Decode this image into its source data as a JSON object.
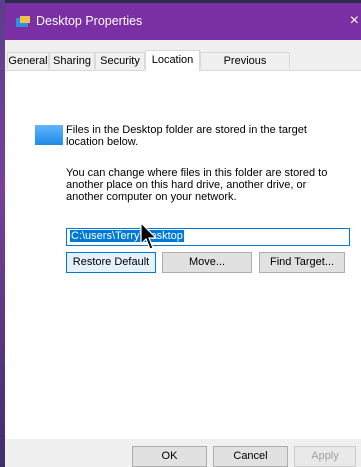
{
  "window": {
    "title": "Desktop Properties",
    "close_glyph": "×"
  },
  "tabs": [
    {
      "label": "General"
    },
    {
      "label": "Sharing"
    },
    {
      "label": "Security"
    },
    {
      "label": "Location",
      "active": true
    },
    {
      "label": "Previous Versions"
    }
  ],
  "location": {
    "info_line": "Files in the Desktop folder are stored in the target location below.",
    "help_text": "You can change where files in this folder are stored to another place on this hard drive, another drive, or another computer on your network.",
    "path_value": "C:\\users\\Terry\\Desktop"
  },
  "buttons": {
    "restore_default": "Restore Default",
    "move": "Move...",
    "find_target": "Find Target...",
    "ok": "OK",
    "cancel": "Cancel",
    "apply": "Apply"
  },
  "icons": {
    "app": "folder-properties-icon",
    "folder": "folder-icon",
    "cursor": "mouse-pointer-icon"
  },
  "colors": {
    "titlebar": "#7b2fa4",
    "accent": "#0078d7"
  }
}
